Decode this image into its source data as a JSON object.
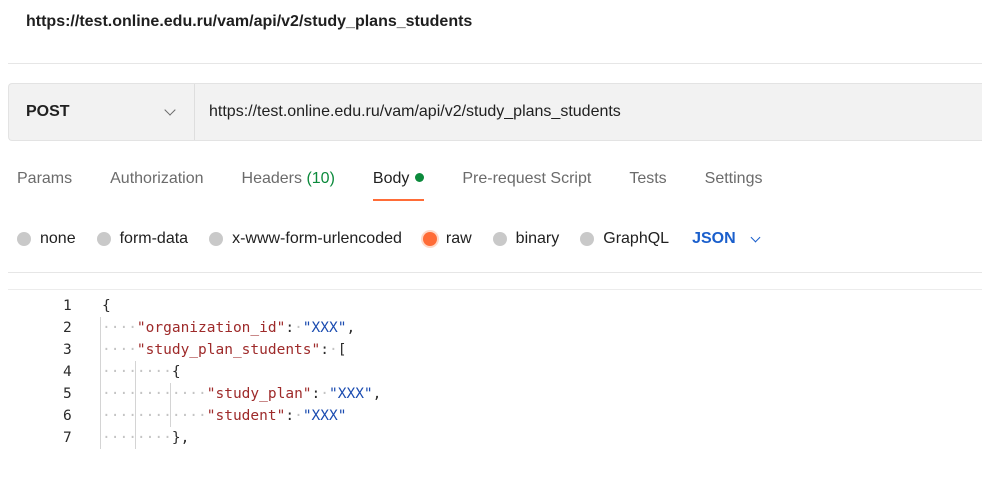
{
  "page_url_title": "https://test.online.edu.ru/vam/api/v2/study_plans_students",
  "request": {
    "method": "POST",
    "url": "https://test.online.edu.ru/vam/api/v2/study_plans_students"
  },
  "tabs": [
    {
      "label": "Params"
    },
    {
      "label": "Authorization"
    },
    {
      "label": "Headers",
      "count": "(10)"
    },
    {
      "label": "Body",
      "active": true
    },
    {
      "label": "Pre-request Script"
    },
    {
      "label": "Tests"
    },
    {
      "label": "Settings"
    }
  ],
  "body_options": [
    {
      "label": "none",
      "checked": false
    },
    {
      "label": "form-data",
      "checked": false
    },
    {
      "label": "x-www-form-urlencoded",
      "checked": false
    },
    {
      "label": "raw",
      "checked": true
    },
    {
      "label": "binary",
      "checked": false
    },
    {
      "label": "GraphQL",
      "checked": false
    }
  ],
  "body_format": "JSON",
  "colors": {
    "accent": "#ff6c37",
    "success": "#0c8a3c",
    "link": "#1a5fcc"
  },
  "editor": {
    "lines": [
      {
        "num": "1",
        "ws": "",
        "tokens": [
          [
            "punc",
            "{"
          ]
        ]
      },
      {
        "num": "2",
        "ws": "····",
        "tokens": [
          [
            "key",
            "\"organization_id\""
          ],
          [
            "punc",
            ":"
          ],
          [
            "ws",
            "·"
          ],
          [
            "str",
            "\"XXX\""
          ],
          [
            "punc",
            ","
          ]
        ]
      },
      {
        "num": "3",
        "ws": "····",
        "tokens": [
          [
            "key",
            "\"study_plan_students\""
          ],
          [
            "punc",
            ":"
          ],
          [
            "ws",
            "·"
          ],
          [
            "punc",
            "["
          ]
        ]
      },
      {
        "num": "4",
        "ws": "········",
        "tokens": [
          [
            "punc",
            "{"
          ]
        ]
      },
      {
        "num": "5",
        "ws": "············",
        "tokens": [
          [
            "key",
            "\"study_plan\""
          ],
          [
            "punc",
            ":"
          ],
          [
            "ws",
            "·"
          ],
          [
            "str",
            "\"XXX\""
          ],
          [
            "punc",
            ","
          ]
        ]
      },
      {
        "num": "6",
        "ws": "············",
        "tokens": [
          [
            "key",
            "\"student\""
          ],
          [
            "punc",
            ":"
          ],
          [
            "ws",
            "·"
          ],
          [
            "str",
            "\"XXX\""
          ]
        ]
      },
      {
        "num": "7",
        "ws": "········",
        "tokens": [
          [
            "punc",
            "},"
          ]
        ]
      }
    ]
  }
}
